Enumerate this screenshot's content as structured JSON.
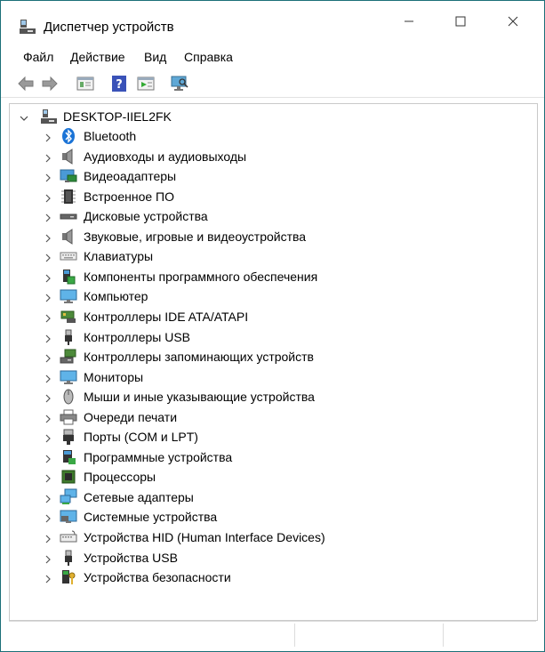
{
  "window": {
    "title": "Диспетчер устройств"
  },
  "menu": [
    "Файл",
    "Действие",
    "Вид",
    "Справка"
  ],
  "tree": {
    "root": "DESKTOP-IIEL2FK",
    "items": [
      {
        "label": "Bluetooth",
        "icon": "bluetooth-icon"
      },
      {
        "label": "Аудиовходы и аудиовыходы",
        "icon": "speaker-icon"
      },
      {
        "label": "Видеоадаптеры",
        "icon": "display-adapter-icon"
      },
      {
        "label": "Встроенное ПО",
        "icon": "firmware-chip-icon"
      },
      {
        "label": "Дисковые устройства",
        "icon": "disk-drive-icon"
      },
      {
        "label": "Звуковые, игровые и видеоустройства",
        "icon": "speaker-icon"
      },
      {
        "label": "Клавиатуры",
        "icon": "keyboard-icon"
      },
      {
        "label": "Компоненты программного обеспечения",
        "icon": "software-component-icon"
      },
      {
        "label": "Компьютер",
        "icon": "computer-monitor-icon"
      },
      {
        "label": "Контроллеры IDE ATA/ATAPI",
        "icon": "ide-controller-icon"
      },
      {
        "label": "Контроллеры USB",
        "icon": "usb-plug-icon"
      },
      {
        "label": "Контроллеры запоминающих устройств",
        "icon": "storage-controller-icon"
      },
      {
        "label": "Мониторы",
        "icon": "monitor-icon"
      },
      {
        "label": "Мыши и иные указывающие устройства",
        "icon": "mouse-icon"
      },
      {
        "label": "Очереди печати",
        "icon": "printer-icon"
      },
      {
        "label": "Порты (COM и LPT)",
        "icon": "port-connector-icon"
      },
      {
        "label": "Программные устройства",
        "icon": "software-device-icon"
      },
      {
        "label": "Процессоры",
        "icon": "processor-icon"
      },
      {
        "label": "Сетевые адаптеры",
        "icon": "network-adapter-icon"
      },
      {
        "label": "Системные устройства",
        "icon": "system-device-icon"
      },
      {
        "label": "Устройства HID (Human Interface Devices)",
        "icon": "hid-icon"
      },
      {
        "label": "Устройства USB",
        "icon": "usb-plug-icon"
      },
      {
        "label": "Устройства безопасности",
        "icon": "security-key-icon"
      }
    ]
  },
  "toolbar": {
    "buttons": [
      "back-arrow-icon",
      "forward-arrow-icon",
      "properties-icon",
      "help-icon",
      "update-driver-icon",
      "scan-hardware-icon"
    ]
  }
}
